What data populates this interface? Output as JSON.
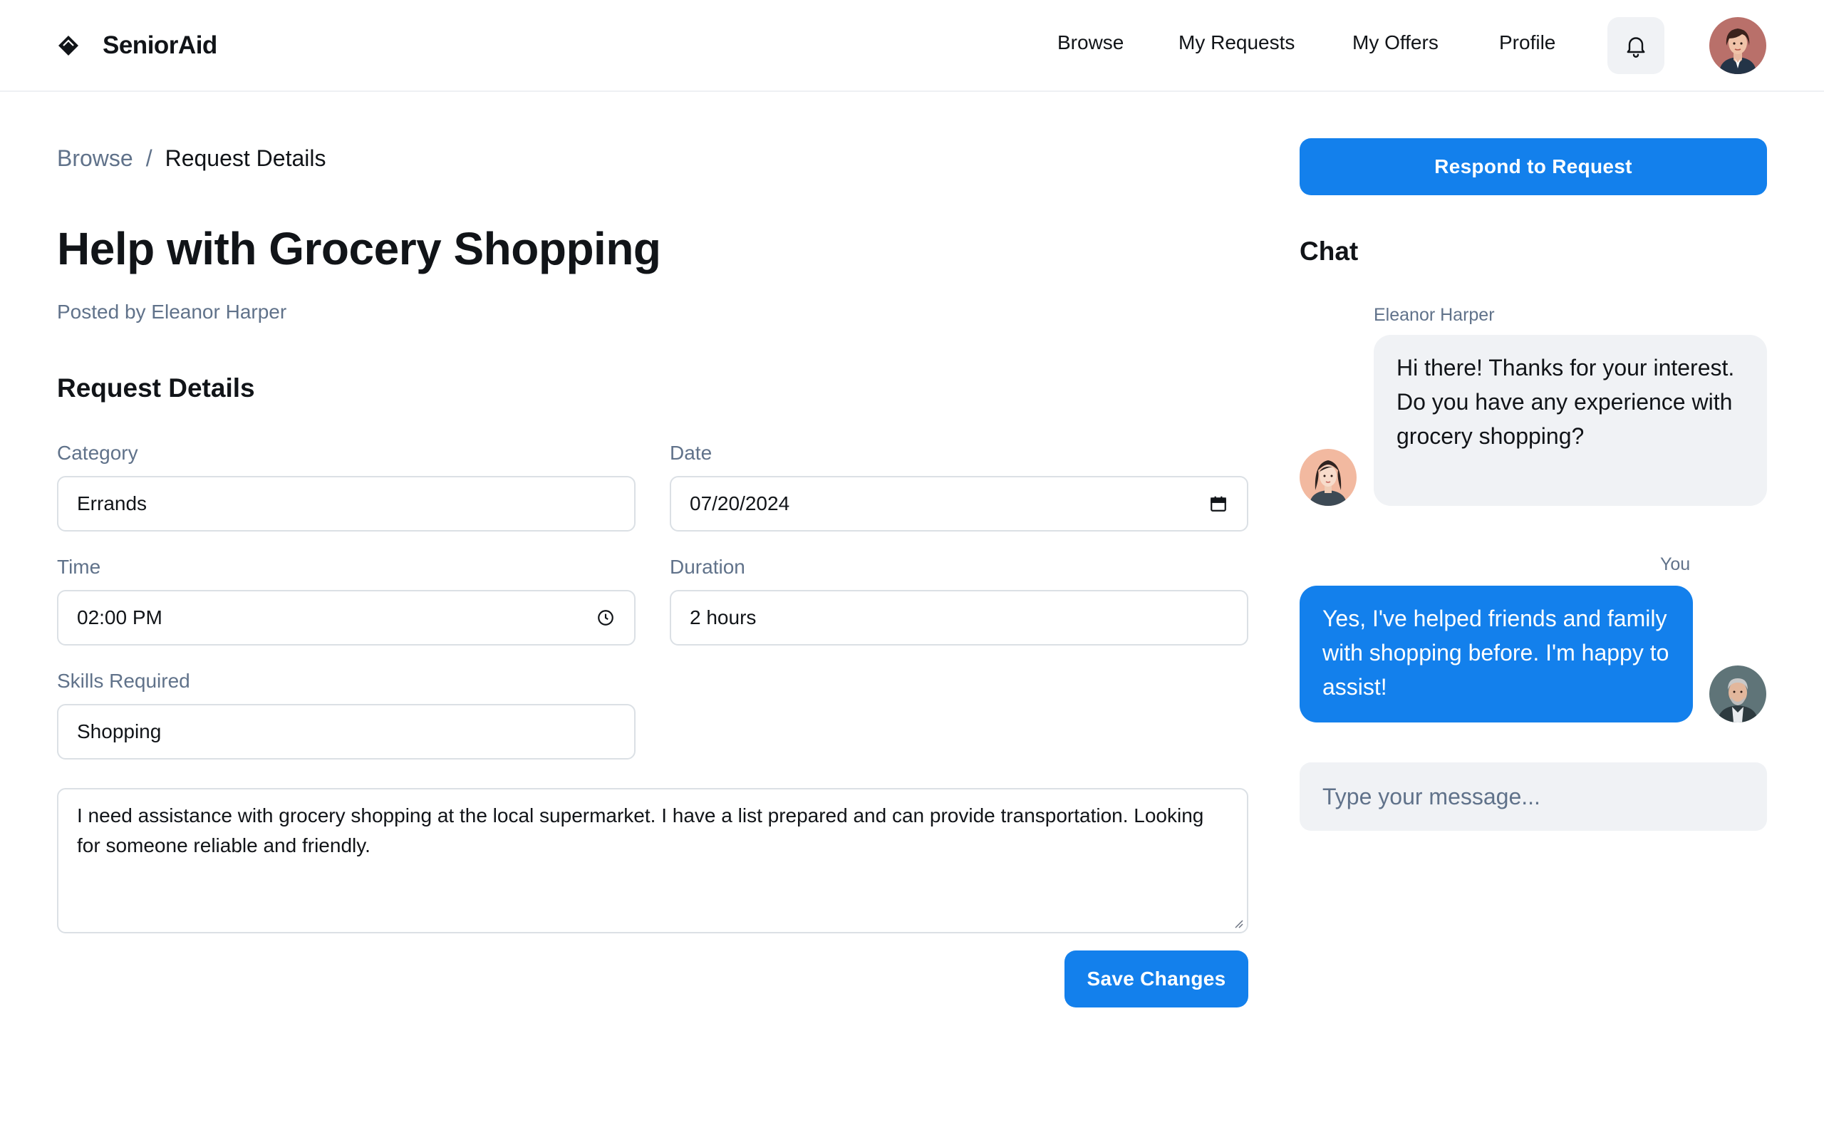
{
  "header": {
    "brand_name": "SeniorAid",
    "nav": [
      {
        "label": "Browse"
      },
      {
        "label": "My Requests"
      },
      {
        "label": "My Offers"
      },
      {
        "label": "Profile"
      }
    ],
    "icons": {
      "logo": "diamond-logo-icon",
      "notifications": "bell-icon",
      "user": "user-avatar"
    }
  },
  "breadcrumb": {
    "parent": "Browse",
    "separator": "/",
    "current": "Request Details"
  },
  "request": {
    "title": "Help with Grocery Shopping",
    "posted_by": "Posted by Eleanor Harper",
    "section_title": "Request Details",
    "fields": {
      "category": {
        "label": "Category",
        "value": "Errands"
      },
      "date": {
        "label": "Date",
        "value": "07/20/2024",
        "icon": "calendar-icon"
      },
      "time": {
        "label": "Time",
        "value": "02:00 PM",
        "icon": "clock-icon"
      },
      "duration": {
        "label": "Duration",
        "value": "2 hours"
      },
      "skills": {
        "label": "Skills Required",
        "value": "Shopping"
      }
    },
    "description": "I need assistance with grocery shopping at the local supermarket. I have a list prepared and can provide transportation. Looking for someone reliable and friendly.",
    "save_label": "Save Changes"
  },
  "sidebar": {
    "respond_label": "Respond to Request",
    "chat_title": "Chat",
    "messages": [
      {
        "sender": "Eleanor Harper",
        "text": "Hi there! Thanks for your interest. Do you have any experience with grocery shopping?"
      },
      {
        "sender": "You",
        "text": "Yes, I've helped friends and family with shopping before. I'm happy to assist!"
      }
    ],
    "input_placeholder": "Type your message..."
  },
  "colors": {
    "primary": "#1380ec",
    "muted_text": "#60728a",
    "surface": "#f0f2f5",
    "border": "#dbe0e5",
    "text": "#111418"
  }
}
